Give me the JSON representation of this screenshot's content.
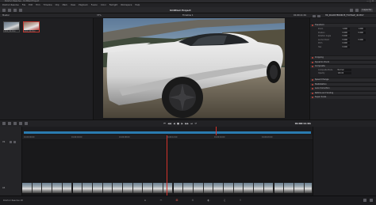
{
  "os_bar": {
    "title": "DaVinci Resolve - Untitled Project",
    "controls": "— ▢ ✕"
  },
  "menu": [
    "DaVinci Resolve",
    "File",
    "Edit",
    "Trim",
    "Timeline",
    "Clip",
    "Mark",
    "View",
    "Playback",
    "Fusion",
    "Color",
    "Fairlight",
    "Workspace",
    "Help"
  ],
  "toolbar": {
    "project_title": "Untitled Project",
    "right_buttons": [
      "Inspector"
    ]
  },
  "media_pool": {
    "header": "Master",
    "clips": [
      {
        "label": "shot_01.mov"
      },
      {
        "label": "shot_02.mov"
      }
    ]
  },
  "viewer": {
    "zoom": "37%",
    "timeline_name": "Timeline 1",
    "timecode_top": "01:00:11:01"
  },
  "inspector": {
    "clip_name": "HD_ROADSTERDRIVE_FOOTAGE_4K.MOV",
    "sections": [
      {
        "label": "Transform"
      },
      {
        "label": "Cropping"
      },
      {
        "label": "Dynamic Zoom"
      },
      {
        "label": "Composite"
      },
      {
        "label": "Speed Change"
      },
      {
        "label": "Stabilization"
      },
      {
        "label": "Lens Correction"
      },
      {
        "label": "Retime and Scaling"
      },
      {
        "label": "Super Scale"
      }
    ],
    "transform_rows": [
      {
        "key": "Zoom",
        "a": "1.000",
        "b": "1.000"
      },
      {
        "key": "Position",
        "a": "0.000",
        "b": "0.000"
      },
      {
        "key": "Rotation Angle",
        "a": "0.000",
        "b": ""
      },
      {
        "key": "Anchor Point",
        "a": "0.000",
        "b": "0.000"
      },
      {
        "key": "Pitch",
        "a": "0.000",
        "b": ""
      },
      {
        "key": "Yaw",
        "a": "0.000",
        "b": ""
      }
    ],
    "composite_rows": [
      {
        "key": "Composite Mode",
        "value": "Normal"
      },
      {
        "key": "Opacity",
        "value": "100.00"
      }
    ]
  },
  "transport": {
    "timecode": "01:00:11:01",
    "buttons": [
      "⏮",
      "◀◀",
      "◀",
      "■",
      "▶",
      "▶▶",
      "⏭",
      "⟳"
    ]
  },
  "ruler": [
    "01:00:00:00",
    "01:00:04:00",
    "01:00:08:00",
    "01:00:12:00",
    "01:00:16:00",
    "01:00:20:00"
  ],
  "tracks": {
    "v1": "V1",
    "a1": "A1"
  },
  "page_bar": {
    "app": "DaVinci Resolve 18",
    "pages": [
      "⌂",
      "✂",
      "⊞",
      "⊙",
      "◐",
      "♫",
      "⇪"
    ],
    "active_index": 2
  },
  "colors": {
    "accent": "#d3322b",
    "track_blue": "#2a7bb0"
  }
}
